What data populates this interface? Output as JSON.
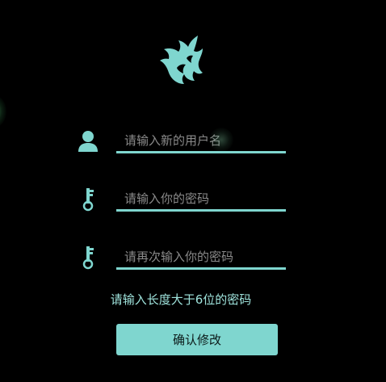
{
  "form": {
    "new_username_placeholder": "请输入新的用户名",
    "password_placeholder": "请输入你的密码",
    "confirm_password_placeholder": "请再次输入你的密码",
    "hint": "请输入长度大于6位的密码",
    "submit_label": "确认修改"
  },
  "icons": {
    "logo": "flame-logo-icon",
    "username": "user-icon",
    "password": "key-icon",
    "confirm_password": "key-icon"
  },
  "colors": {
    "background": "#000000",
    "accent": "#7fd6cf",
    "placeholder": "#8a8a8a",
    "hint_text": "#9fe3dc"
  }
}
